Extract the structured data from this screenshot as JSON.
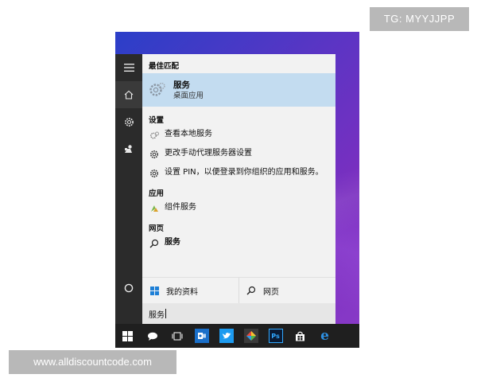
{
  "watermarks": {
    "top": "TG: MYYJJPP",
    "bottom": "www.alldiscountcode.com"
  },
  "colors": {
    "rail_bg": "#2b2b2b",
    "panel_bg": "#f2f2f2",
    "best_match_bg": "#c3dcf0",
    "taskbar_bg": "#1f1f1f",
    "desktop_accent": "#6a35c4"
  },
  "rail": {
    "items": [
      {
        "name": "hamburger-icon"
      },
      {
        "name": "home-icon"
      },
      {
        "name": "settings-gear-icon"
      },
      {
        "name": "user-feedback-icon"
      }
    ],
    "cortana": {
      "name": "cortana-circle-icon"
    }
  },
  "results": {
    "best_match": {
      "header": "最佳匹配",
      "title": "服务",
      "subtitle": "桌面应用",
      "icon": "services-gear-icon"
    },
    "settings": {
      "header": "设置",
      "items": [
        {
          "label": "查看本地服务",
          "icon": "local-services-icon"
        },
        {
          "label": "更改手动代理服务器设置",
          "icon": "gear-icon"
        },
        {
          "label": "设置 PIN，以便登录到你组织的应用和服务。",
          "icon": "gear-icon"
        }
      ]
    },
    "apps": {
      "header": "应用",
      "items": [
        {
          "label": "组件服务",
          "icon": "component-services-icon"
        }
      ]
    },
    "web": {
      "header": "网页",
      "items": [
        {
          "label": "服务",
          "icon": "search-icon"
        }
      ]
    }
  },
  "bottom_tiles": {
    "my_stuff": {
      "label": "我的资料",
      "icon": "windows-logo-icon"
    },
    "web": {
      "label": "网页",
      "icon": "search-icon"
    }
  },
  "search": {
    "value": "服务"
  },
  "taskbar": {
    "items": [
      {
        "name": "start-windows-icon"
      },
      {
        "name": "cortana-search-icon"
      },
      {
        "name": "task-view-icon"
      },
      {
        "name": "outlook-app-icon"
      },
      {
        "name": "twitter-app-icon"
      },
      {
        "name": "paint-app-icon"
      },
      {
        "name": "photoshop-app-icon",
        "label": "Ps"
      },
      {
        "name": "store-bag-icon"
      },
      {
        "name": "edge-browser-icon",
        "label": "e"
      }
    ]
  }
}
